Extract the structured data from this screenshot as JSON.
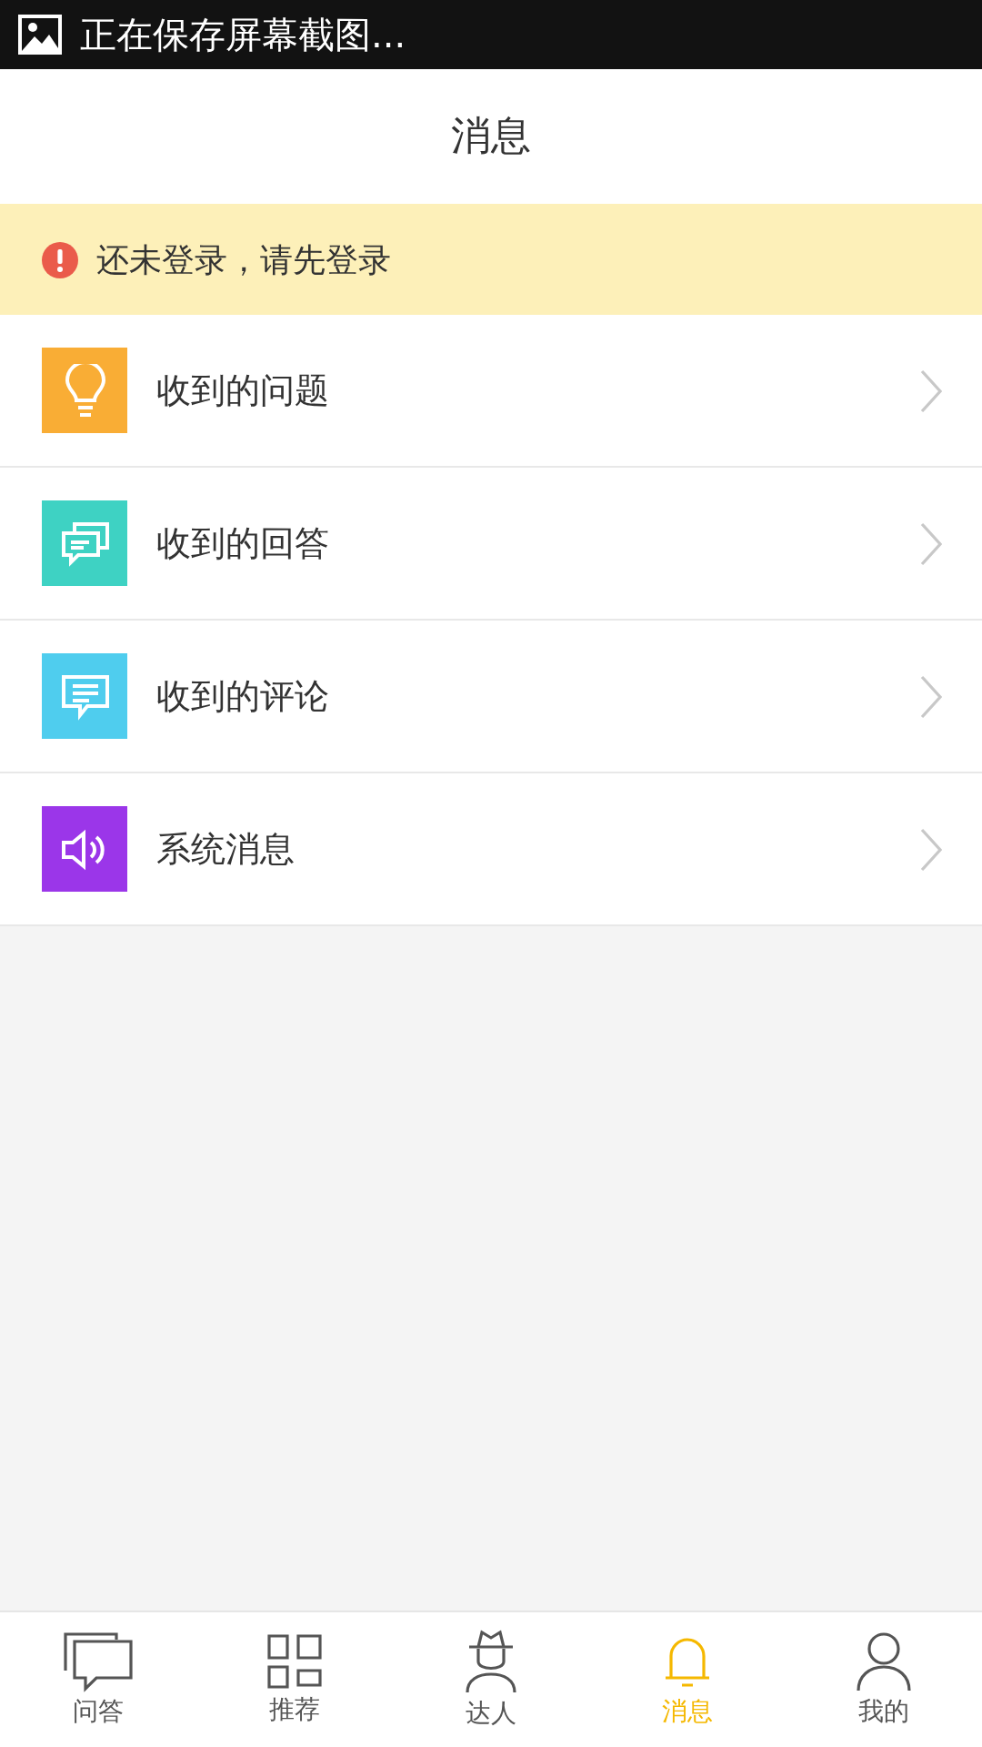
{
  "status_bar": {
    "notification": "正在保存屏幕截图..."
  },
  "header": {
    "title": "消息"
  },
  "notice": {
    "text": "还未登录，请先登录"
  },
  "items": [
    {
      "label": "收到的问题",
      "kind": "bulb",
      "color": "#f9ad35"
    },
    {
      "label": "收到的回答",
      "kind": "chats",
      "color": "#3ed2c3"
    },
    {
      "label": "收到的评论",
      "kind": "comment",
      "color": "#4fcdee"
    },
    {
      "label": "系统消息",
      "kind": "speaker",
      "color": "#9b36e9"
    }
  ],
  "tabs": [
    {
      "label": "问答",
      "kind": "chats",
      "selected": false
    },
    {
      "label": "推荐",
      "kind": "grid",
      "selected": false
    },
    {
      "label": "达人",
      "kind": "person",
      "selected": false
    },
    {
      "label": "消息",
      "kind": "bell",
      "selected": true
    },
    {
      "label": "我的",
      "kind": "user",
      "selected": false
    }
  ]
}
